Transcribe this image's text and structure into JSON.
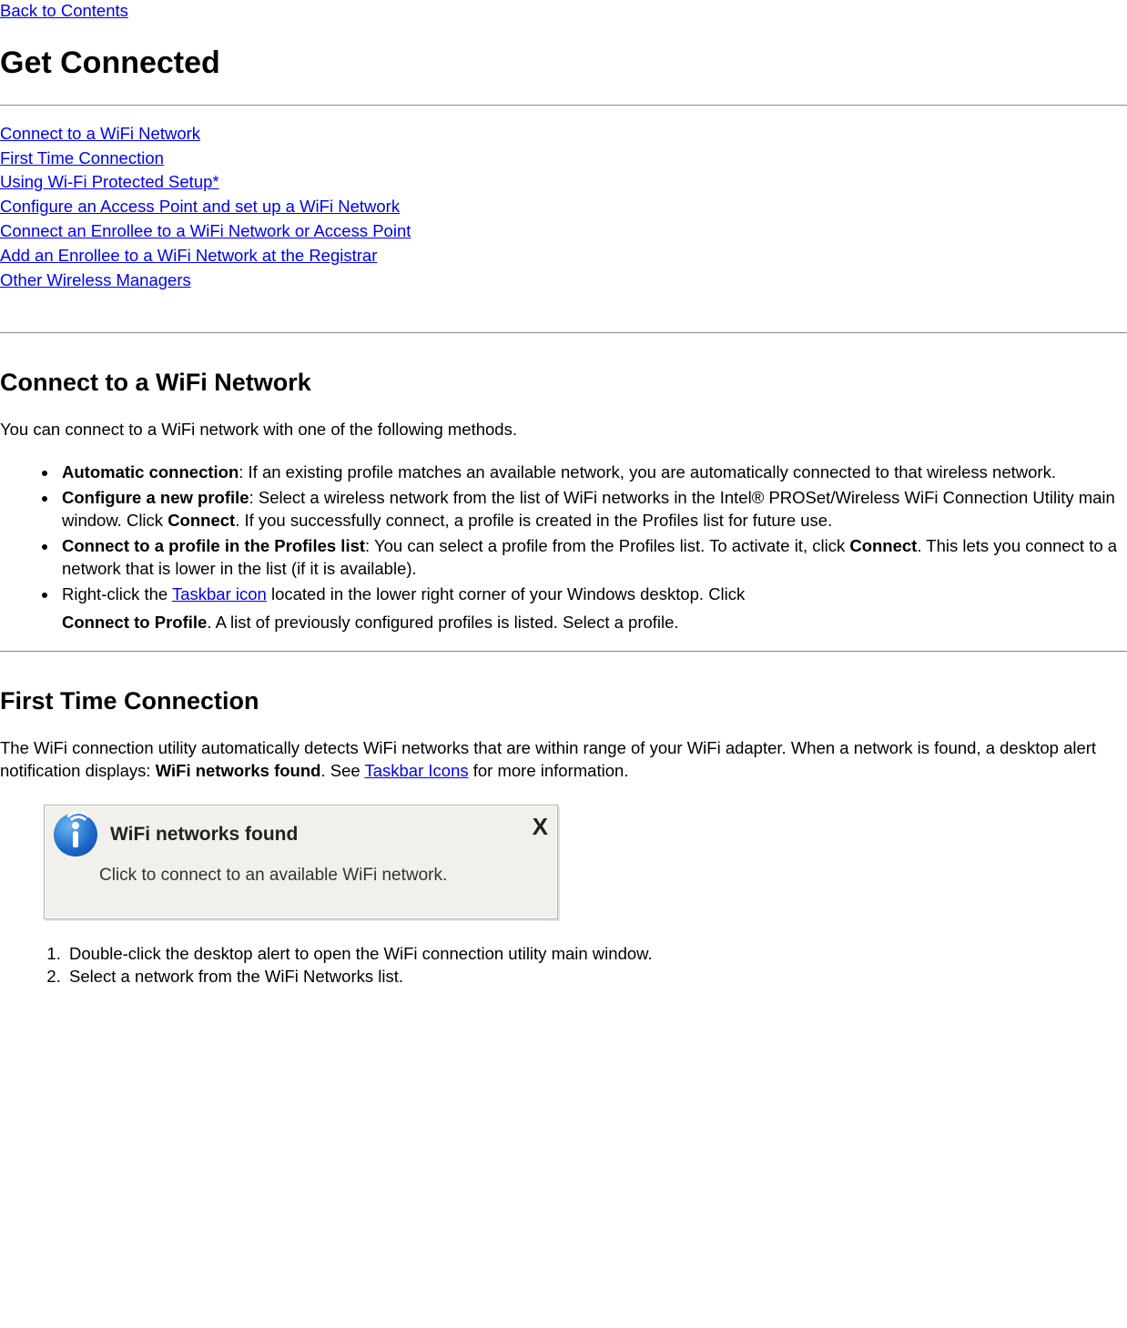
{
  "nav": {
    "back": "Back to Contents"
  },
  "title": "Get Connected",
  "toc": {
    "link1": "Connect to a WiFi Network",
    "link2": "First Time Connection",
    "link3": "Using Wi-Fi Protected Setup*",
    "link4": "Configure an Access Point and set up a WiFi Network ",
    "link5": "Connect an Enrollee to a WiFi Network or Access Point ",
    "link6": "Add an Enrollee to a WiFi Network at the Registrar",
    "link7": "Other Wireless Managers"
  },
  "section1": {
    "heading": "Connect to a WiFi Network",
    "intro": "You can connect to a WiFi network with one of the following methods.",
    "b1_strong": "Automatic connection",
    "b1_rest": ": If an existing profile matches an available network, you are automatically connected to that wireless network.",
    "b2_strong": "Configure a new profile",
    "b2_rest_a": ": Select a wireless network from the list of WiFi networks in the Intel® PROSet/Wireless WiFi Connection Utility main window. Click ",
    "b2_connect": "Connect",
    "b2_rest_b": ". If you successfully connect, a profile is created in the Profiles list for future use.",
    "b3_strong": "Connect to a profile in the Profiles list",
    "b3_rest_a": ": You can select a profile from the Profiles list. To activate it, click ",
    "b3_connect": "Connect",
    "b3_rest_b": ". This lets you connect to a network that is lower in the list (if it is available).",
    "b4_a": "Right-click the ",
    "b4_link": "Taskbar icon",
    "b4_b": " located in the lower right corner of your Windows desktop. Click ",
    "b4_strong": "Connect to Profile",
    "b4_c": ". A list of previously configured profiles is listed. Select a profile."
  },
  "section2": {
    "heading": "First Time Connection",
    "p_a": "The WiFi connection utility automatically detects WiFi networks that are within range of your WiFi adapter. When a network is found, a desktop alert notification displays: ",
    "p_strong": "WiFi networks found",
    "p_b": ". See ",
    "p_link": "Taskbar Icons",
    "p_c": " for more information.",
    "notif_title": "WiFi networks found",
    "notif_close": "X",
    "notif_body": "Click to connect to an available WiFi network.",
    "ol1": "Double-click the desktop alert to open the WiFi connection utility main window.",
    "ol2": "Select a network from the WiFi Networks list."
  }
}
